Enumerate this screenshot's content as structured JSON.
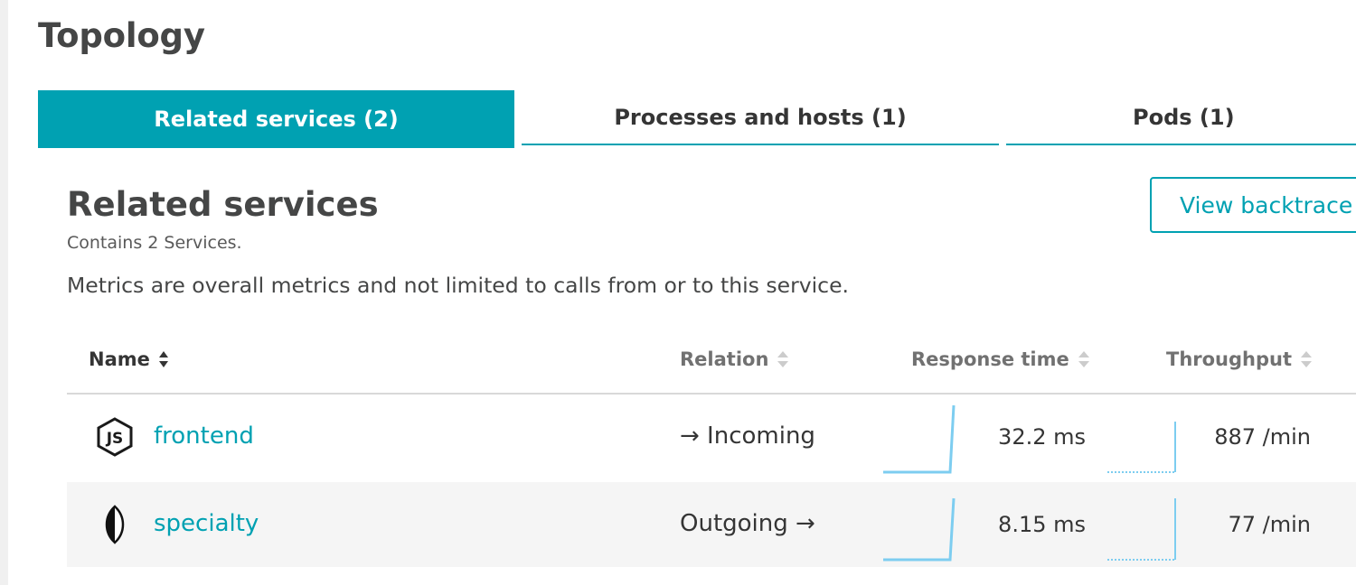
{
  "page": {
    "title": "Topology"
  },
  "tabs": [
    {
      "label": "Related services (2)",
      "active": true
    },
    {
      "label": "Processes and hosts (1)",
      "active": false
    },
    {
      "label": "Pods (1)",
      "active": false
    }
  ],
  "section": {
    "title": "Related services",
    "subtitle": "Contains 2 Services.",
    "note": "Metrics are overall metrics and not limited to calls from or to this service.",
    "view_button": "View backtrace"
  },
  "table": {
    "columns": [
      {
        "label": "Name",
        "sort_icon": "sort-both-icon"
      },
      {
        "label": "Relation",
        "sort_icon": "sort-both-icon"
      },
      {
        "label": "Response time",
        "sort_icon": "sort-both-icon"
      },
      {
        "label": "Throughput",
        "sort_icon": "sort-both-icon"
      }
    ],
    "rows": [
      {
        "icon": "nodejs-icon",
        "name": "frontend",
        "relation": "→ Incoming",
        "response_time": "32.2 ms",
        "throughput": "887 /min"
      },
      {
        "icon": "mongodb-icon",
        "name": "specialty",
        "relation": "Outgoing →",
        "response_time": "8.15 ms",
        "throughput": "77 /min"
      }
    ]
  },
  "colors": {
    "accent": "#00a1b2",
    "text": "#353535",
    "muted": "#717171",
    "sparkline": "#7dcdf0",
    "row_alt": "#f5f5f5"
  }
}
